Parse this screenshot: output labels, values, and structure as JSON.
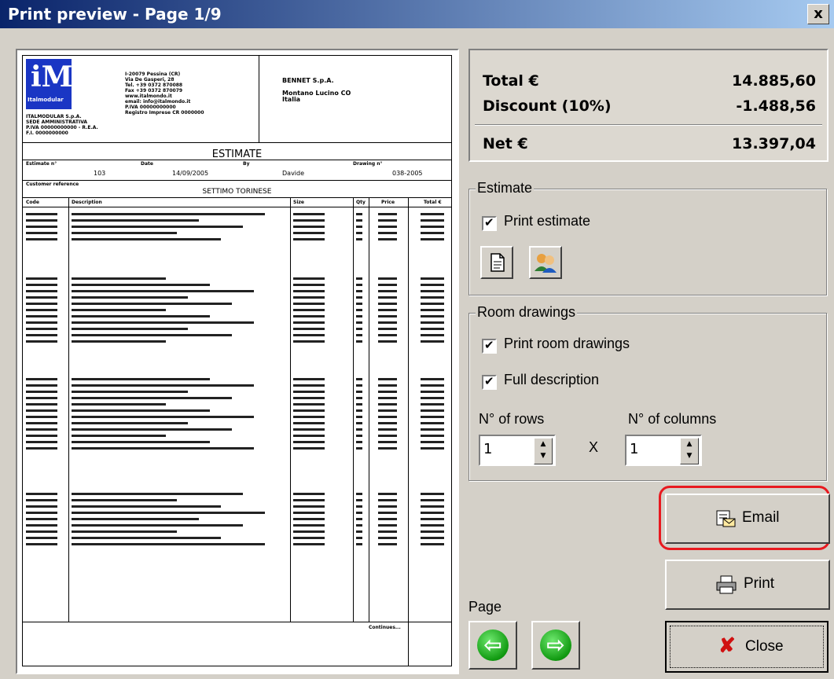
{
  "window": {
    "title": "Print preview - Page 1/9",
    "close_glyph": "x"
  },
  "document": {
    "company_lines": [
      "I-20079 Pessina (CR)",
      "Via De Gasperi, 28",
      "Tel. +39 0372 870088",
      "Fax +39 0372 870079",
      "www.italmondo.it",
      "email: info@italmondo.it",
      "P.IVA 00000000000",
      "Registro Imprese CR 0000000"
    ],
    "left_lines": [
      "ITALMODULAR S.p.A.",
      "SEDE AMMINISTRATIVA",
      "P.IVA 00000000000 - R.E.A.",
      "F.I. 0000000000"
    ],
    "customer": [
      "BENNET S.p.A.",
      "Montano Lucino CO",
      "Italia"
    ],
    "title": "ESTIMATE",
    "header_labels": [
      "Estimate n°",
      "Date",
      "By",
      "Drawing n°"
    ],
    "header_values": [
      "103",
      "14/09/2005",
      "Davide",
      "038-2005"
    ],
    "customer_reference_label": "Customer reference",
    "section_title": "SETTIMO TORINESE",
    "columns": [
      "Code",
      "Description",
      "Size",
      "Qty",
      "Price",
      "Total €"
    ],
    "footer_label": "Continues..."
  },
  "totals": {
    "total_label": "Total €",
    "total_value": "14.885,60",
    "discount_label": "Discount (10%)",
    "discount_value": "-1.488,56",
    "net_label": "Net €",
    "net_value": "13.397,04"
  },
  "estimate_group": {
    "legend": "Estimate",
    "print_estimate": "Print estimate",
    "print_estimate_checked": true
  },
  "room_group": {
    "legend": "Room drawings",
    "print_room": "Print room drawings",
    "print_room_checked": true,
    "full_desc": "Full description",
    "full_desc_checked": true,
    "rows_label": "N° of rows",
    "cols_label": "N° of columns",
    "rows_value": "1",
    "cols_value": "1",
    "times": "X"
  },
  "buttons": {
    "email": "Email",
    "print": "Print",
    "close": "Close"
  },
  "page_label": "Page",
  "colors": {
    "titlebar_start": "#0a246a",
    "titlebar_end": "#a6caf0",
    "highlight": "#e8191f",
    "face": "#d4d0c8"
  }
}
